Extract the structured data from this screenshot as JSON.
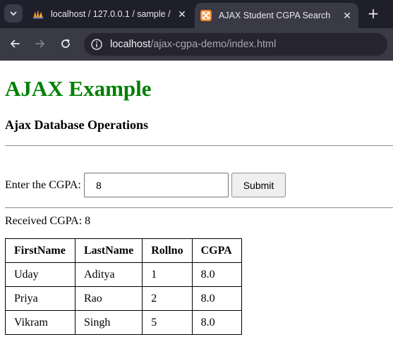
{
  "browser": {
    "tabs": [
      {
        "title": "localhost / 127.0.0.1 / sample / ",
        "favicon": "phpmyadmin-icon",
        "active": false
      },
      {
        "title": "AJAX Student CGPA Search",
        "favicon": "xampp-icon",
        "active": true
      }
    ],
    "close_glyph": "✕",
    "new_tab_glyph": "+",
    "address": {
      "host": "localhost",
      "path": "/ajax-cgpa-demo/index.html"
    }
  },
  "page": {
    "heading": "AJAX Example",
    "subheading": "Ajax Database Operations",
    "cgpa_label": "Enter the CGPA:",
    "cgpa_value": "8",
    "submit_label": "Submit",
    "received_text": "Received CGPA: 8",
    "table": {
      "headers": [
        "FirstName",
        "LastName",
        "Rollno",
        "CGPA"
      ],
      "rows": [
        [
          "Uday",
          "Aditya",
          "1",
          "8.0"
        ],
        [
          "Priya",
          "Rao",
          "2",
          "8.0"
        ],
        [
          "Vikram",
          "Singh",
          "5",
          "8.0"
        ]
      ]
    }
  },
  "colors": {
    "heading": "#008000",
    "tabstrip": "#1f1e2b",
    "toolbar": "#3a3946",
    "xampp_orange": "#f58220"
  }
}
